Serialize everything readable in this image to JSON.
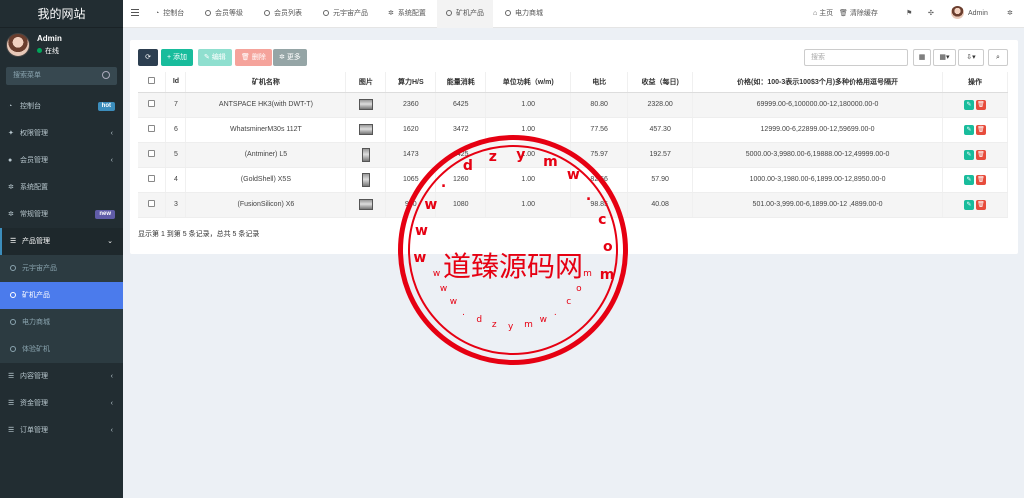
{
  "sidebar": {
    "brand": "我的网站",
    "user": {
      "name": "Admin",
      "status": "在线"
    },
    "search_placeholder": "搜索菜单",
    "items": [
      {
        "label": "控制台",
        "icon": "dashboard-icon",
        "badge": "hot",
        "badge_color": "#3c8dbc"
      },
      {
        "label": "权限管理",
        "icon": "users-icon"
      },
      {
        "label": "会员管理",
        "icon": "user-icon"
      },
      {
        "label": "系统配置",
        "icon": "gear-icon"
      },
      {
        "label": "常规管理",
        "icon": "cogs-icon",
        "badge": "new",
        "badge_color": "#605ca8"
      },
      {
        "label": "产品管理",
        "icon": "list-icon"
      },
      {
        "label": "内容管理",
        "icon": "list-icon"
      },
      {
        "label": "资金管理",
        "icon": "list-icon"
      },
      {
        "label": "订单管理",
        "icon": "list-icon"
      }
    ],
    "sub_items": [
      "元宇宙产品",
      "矿机产品",
      "电力商城",
      "体验矿机"
    ]
  },
  "topbar": {
    "tabs": [
      "控制台",
      "会员等级",
      "会员列表",
      "元宇宙产品",
      "系统配置",
      "矿机产品",
      "电力商城"
    ],
    "home": "主页",
    "clear_cache": "清除缓存",
    "admin": "Admin"
  },
  "toolbar": {
    "refresh": "⟳",
    "add": "添加",
    "edit": "编辑",
    "delete": "删除",
    "more": "更多",
    "search_placeholder": "搜索"
  },
  "table": {
    "headers": [
      "Id",
      "矿机名称",
      "图片",
      "算力H/S",
      "能量消耗",
      "单位功耗（w/m)",
      "电比",
      "收益（每日)",
      "价格(如：100-3表示100$3个月)多种价格用逗号隔开",
      "操作"
    ],
    "rows": [
      {
        "id": "7",
        "name": "ANTSPACE HK3(with DWT-T)",
        "hashrate": "2360",
        "energy": "6425",
        "unit_power": "1.00",
        "ratio": "80.80",
        "income": "2328.00",
        "price": "69999.00-6,100000.00-12,180000.00-0"
      },
      {
        "id": "6",
        "name": "WhatsminerM30s 112T",
        "hashrate": "1620",
        "energy": "3472",
        "unit_power": "1.00",
        "ratio": "77.56",
        "income": "457.30",
        "price": "12999.00-6,22899.00-12,59699.00-0"
      },
      {
        "id": "5",
        "name": "(Antminer) L5",
        "hashrate": "1473",
        "energy": "1425",
        "unit_power": "1.00",
        "ratio": "75.97",
        "income": "192.57",
        "price": "5000.00-3,9980.00-6,19888.00-12,49999.00-0"
      },
      {
        "id": "4",
        "name": "(GoldShell) X5S",
        "hashrate": "1065",
        "energy": "1260",
        "unit_power": "1.00",
        "ratio": "82.56",
        "income": "57.90",
        "price": "1000.00-3,1980.00-6,1899.00-12,8950.00-0"
      },
      {
        "id": "3",
        "name": "(FusionSilicon) X6",
        "hashrate": "960",
        "energy": "1080",
        "unit_power": "1.00",
        "ratio": "98.85",
        "income": "40.08",
        "price": "501.00-3,999.00-6,1899.00-12 ,4899.00-0"
      }
    ]
  },
  "summary": "显示第 1 到第 5 条记录，总共 5 条记录",
  "watermark": {
    "title": "道臻源码网",
    "top_chars": [
      "w",
      "w",
      "w",
      ".",
      "d",
      "z",
      "y",
      "m",
      "w",
      ".",
      "c",
      "o",
      "m"
    ],
    "bottom_chars": [
      "w",
      "w",
      "w",
      ".",
      "d",
      "z",
      "y",
      "m",
      "w",
      ".",
      "c",
      "o",
      "m"
    ]
  }
}
